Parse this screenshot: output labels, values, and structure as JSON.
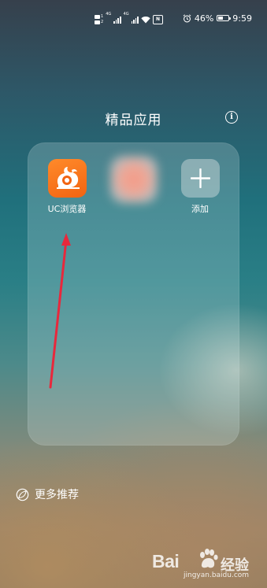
{
  "status_bar": {
    "sim1": "1",
    "sim2": "2",
    "net1": "4G",
    "net2": "4G",
    "nfc": "N",
    "battery_percent": "46%",
    "battery_level": 0.46,
    "time": "9:59"
  },
  "folder": {
    "title": "精品应用",
    "info_glyph": "i"
  },
  "apps": [
    {
      "label": "UC浏览器",
      "icon": "uc-browser-icon",
      "color": "#f26412"
    },
    {
      "label": "",
      "icon": "blurred-app-icon",
      "color": "#f39a86"
    },
    {
      "label": "添加",
      "icon": "plus-icon"
    }
  ],
  "more": {
    "label": "更多推荐",
    "icon": "leaf-icon"
  },
  "watermark": {
    "brand_bai": "Bai",
    "brand_jy": "经验",
    "url": "jingyan.baidu.com"
  },
  "colors": {
    "arrow": "#e8283c"
  }
}
